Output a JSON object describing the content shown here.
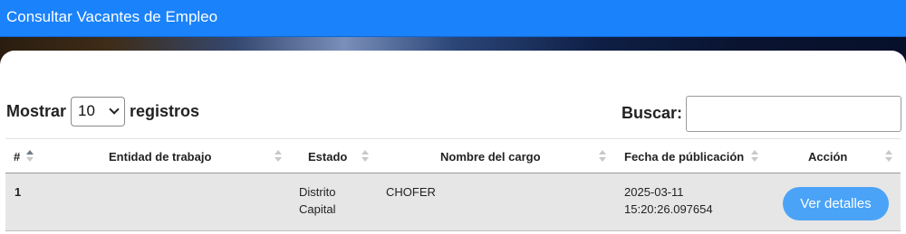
{
  "header": {
    "title": "Consultar Vacantes de Empleo"
  },
  "length": {
    "prefix": "Mostrar",
    "selected": "10",
    "suffix": "registros"
  },
  "search": {
    "label": "Buscar:",
    "value": ""
  },
  "table": {
    "columns": [
      "#",
      "Entidad de trabajo",
      "Estado",
      "Nombre del cargo",
      "Fecha de públicación",
      "Acción"
    ],
    "rows": [
      {
        "num": "1",
        "entidad": "",
        "estado_line1": "Distrito",
        "estado_line2": "Capital",
        "cargo": "CHOFER",
        "fecha_line1": "2025-03-11",
        "fecha_line2": "15:20:26.097654",
        "accion": "Ver detalles"
      }
    ]
  },
  "colors": {
    "header_bg": "#1a82fb",
    "button_bg": "#4aa3f7",
    "row_bg": "#e6e6e6"
  },
  "icons": {
    "sort": "sort-arrows-icon",
    "select": "chevron-down-icon"
  }
}
